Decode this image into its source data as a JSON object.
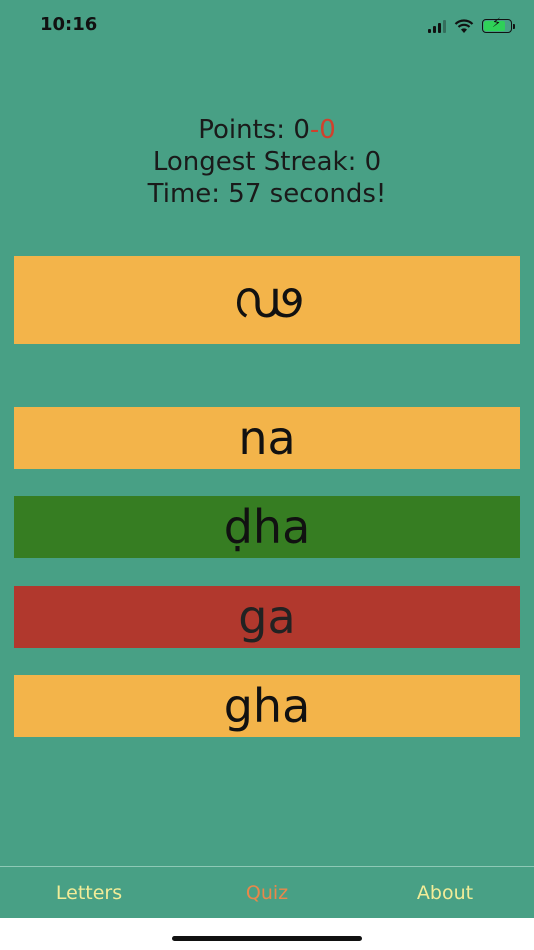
{
  "status_bar": {
    "time": "10:16",
    "icons": [
      "cellular-signal-icon",
      "wifi-icon",
      "battery-charging-icon"
    ]
  },
  "stats": {
    "points_label": "Points: ",
    "points_correct": "0",
    "points_separator": "-",
    "points_wrong": "0",
    "longest_streak": "Longest Streak: 0",
    "time": "Time: 57 seconds!"
  },
  "quiz": {
    "letter": "ഢ",
    "options": [
      {
        "label": "na",
        "state": "neutral"
      },
      {
        "label": "ḍha",
        "state": "correct"
      },
      {
        "label": "ga",
        "state": "wrong"
      },
      {
        "label": "gha",
        "state": "neutral"
      }
    ]
  },
  "tabbar": {
    "letters": "Letters",
    "quiz": "Quiz",
    "about": "About",
    "active": "Quiz"
  },
  "colors": {
    "background": "#48a085",
    "card": "#f3b44a",
    "correct": "#367d22",
    "wrong": "#b1382d",
    "tab_text": "#f2ec98",
    "tab_active": "#e9874a"
  }
}
